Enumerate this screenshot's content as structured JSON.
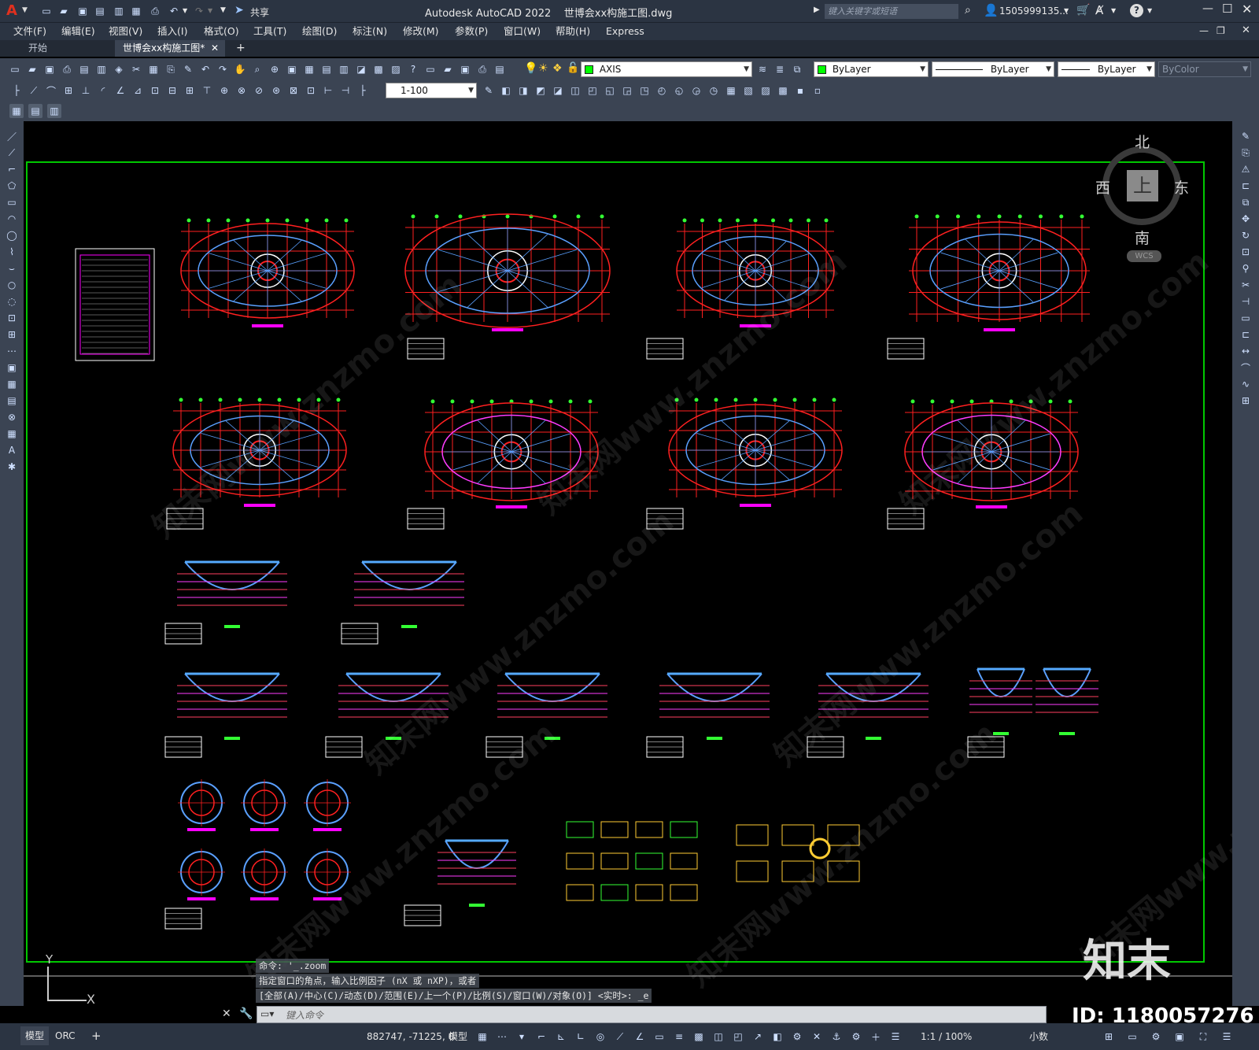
{
  "title_bar": {
    "app_logo": "A",
    "share_label": "共享",
    "window_title": "Autodesk AutoCAD 2022    世博会xx构施工图.dwg",
    "search_placeholder": "键入关键字或短语",
    "user_id": "1505999135...",
    "icons": [
      "new-icon",
      "open-icon",
      "save-icon",
      "saveas-icon",
      "publish-icon",
      "plot-icon",
      "undo-icon",
      "redo-icon",
      "share-icon",
      "search-icon",
      "user-icon",
      "cart-icon",
      "help-icon",
      "minimize-icon",
      "maximize-icon",
      "close-icon"
    ]
  },
  "menu": {
    "items": [
      "文件(F)",
      "编辑(E)",
      "视图(V)",
      "插入(I)",
      "格式(O)",
      "工具(T)",
      "绘图(D)",
      "标注(N)",
      "修改(M)",
      "参数(P)",
      "窗口(W)",
      "帮助(H)",
      "Express"
    ]
  },
  "tabs": {
    "start": "开始",
    "active": "世博会xx构施工图*",
    "add": "+"
  },
  "toolbars": {
    "layer_name": "AXIS",
    "layer_color": "#00ff00",
    "color_prop": "ByLayer",
    "linetype_prop": "ByLayer",
    "lineweight_prop": "ByLayer",
    "plotstyle_prop": "ByColor",
    "dim_scale": "1-100"
  },
  "viewcube": {
    "north": "北",
    "south": "南",
    "east": "东",
    "west": "西",
    "face": "上",
    "ucs": "WCS"
  },
  "command": {
    "history_1": "命令: '_.zoom",
    "history_2": "指定窗口的角点，输入比例因子 (nX 或 nXP)，或者",
    "history_3": "[全部(A)/中心(C)/动态(D)/范围(E)/上一个(P)/比例(S)/窗口(W)/对象(O)] <实时>: _e",
    "input_placeholder": "键入命令"
  },
  "ucs_icon": {
    "y_label": "Y",
    "x_label": "X"
  },
  "status": {
    "layout_model": "模型",
    "layout_orc": "ORC",
    "add_layout": "+",
    "coordinates": "882747, -71225, 0",
    "space": "模型",
    "annotation_scale": "1:1 / 100%",
    "units": "小数"
  },
  "watermark": {
    "logo": "知末",
    "id": "ID: 1180057276",
    "site": "知末网www.znzmo.com"
  },
  "colors": {
    "title_bg": "#2b3442",
    "toolbar_bg": "#3b4453",
    "canvas_bg": "#000000",
    "frame_green": "#00c800",
    "axis_red": "#ff2020",
    "struct_blue": "#5aa0ff",
    "label_magenta": "#ff00ff"
  }
}
